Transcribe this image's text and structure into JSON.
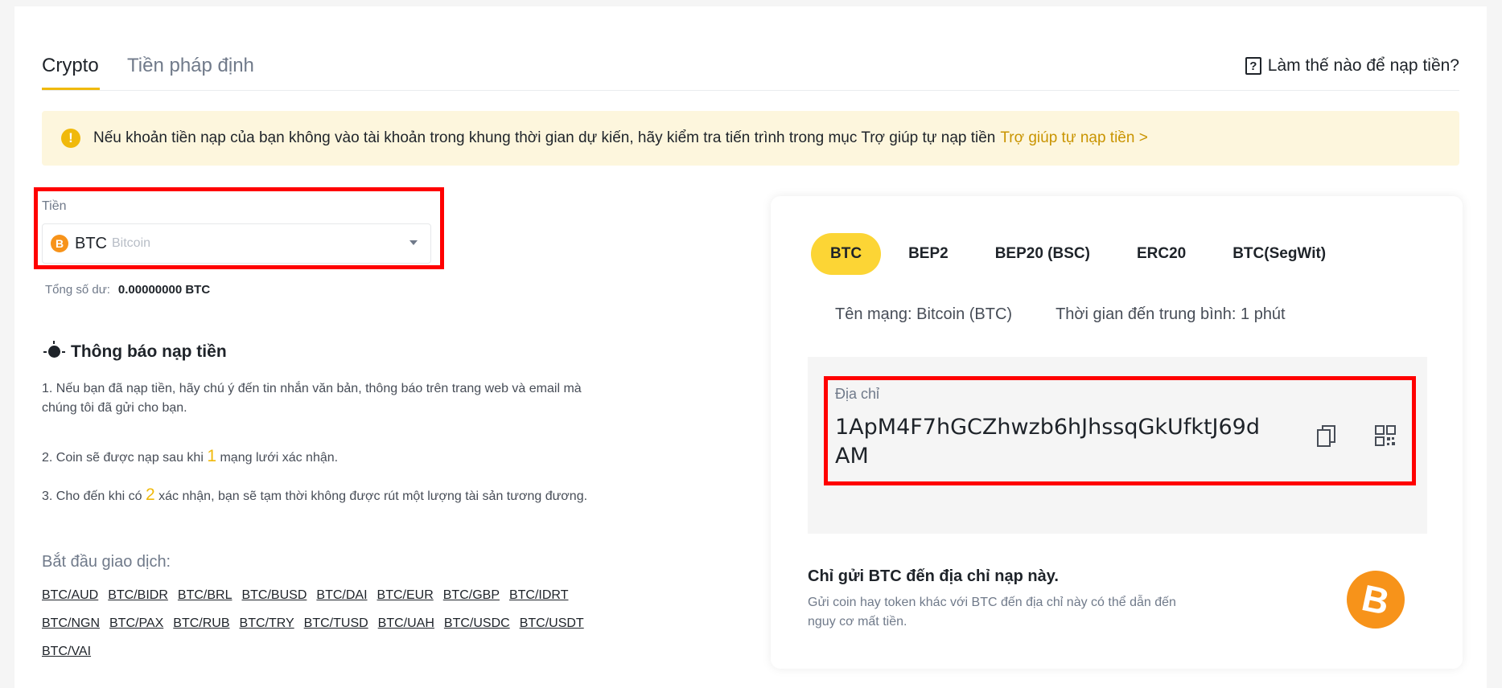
{
  "tabs": [
    {
      "label": "Crypto"
    },
    {
      "label": "Tiền pháp định"
    }
  ],
  "help": {
    "icon": "question-icon",
    "label": "Làm thế nào để nạp tiền?"
  },
  "banner": {
    "icon": "warning-icon",
    "text": "Nếu khoản tiền nạp của bạn không vào tài khoản trong khung thời gian dự kiến, hãy kiểm tra tiến trình trong mục Trợ giúp tự nạp tiền",
    "link": "Trợ giúp tự nạp tiền >"
  },
  "coin": {
    "label": "Tiền",
    "symbol": "BTC",
    "name": "Bitcoin",
    "icon_glyph": "B"
  },
  "balance": {
    "label": "Tổng số dư:",
    "value": "0.00000000 BTC"
  },
  "notice": {
    "title": "Thông báo nạp tiền",
    "item1": "1. Nếu bạn đã nạp tiền, hãy chú ý đến tin nhắn văn bản, thông báo trên trang web và email mà chúng tôi đã gửi cho bạn.",
    "item2_pre": "2. Coin sẽ được nạp sau khi",
    "item2_num": "1",
    "item2_post": "mạng lưới xác nhận.",
    "item3_pre": "3. Cho đến khi có",
    "item3_num": "2",
    "item3_post": "xác nhận, bạn sẽ tạm thời không được rút một lượng tài sản tương đương."
  },
  "trade": {
    "label": "Bắt đầu giao dịch:",
    "pairs": [
      "BTC/AUD",
      "BTC/BIDR",
      "BTC/BRL",
      "BTC/BUSD",
      "BTC/DAI",
      "BTC/EUR",
      "BTC/GBP",
      "BTC/IDRT",
      "BTC/NGN",
      "BTC/PAX",
      "BTC/RUB",
      "BTC/TRY",
      "BTC/TUSD",
      "BTC/UAH",
      "BTC/USDC",
      "BTC/USDT",
      "BTC/VAI"
    ]
  },
  "networks": [
    "BTC",
    "BEP2",
    "BEP20 (BSC)",
    "ERC20",
    "BTC(SegWit)"
  ],
  "network_info": {
    "name": "Tên mạng: Bitcoin (BTC)",
    "time": "Thời gian đến trung bình: 1 phút"
  },
  "address": {
    "label": "Địa chỉ",
    "value": "1ApM4F7hGCZhwzb6hJhssqGkUfktJ69dAM"
  },
  "only_send": "Chỉ gửi BTC đến địa chỉ nạp này.",
  "warning": "Gửi coin hay token khác với BTC đến địa chỉ này có thể dẫn đến nguy cơ mất tiền.",
  "colors": {
    "accent": "#f0b90b",
    "btc": "#f7931a",
    "highlight_box": "#ff0000"
  }
}
